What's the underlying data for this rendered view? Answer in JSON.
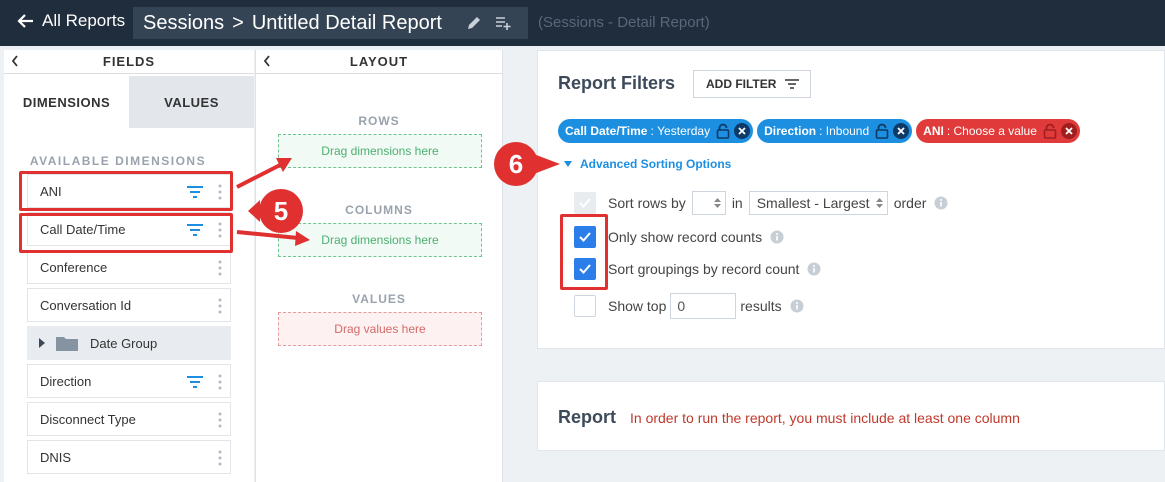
{
  "header": {
    "back_label": "All Reports",
    "breadcrumb_parent": "Sessions",
    "breadcrumb_separator": ">",
    "report_name": "Untitled Detail Report",
    "subtitle": "(Sessions - Detail Report)"
  },
  "fields_panel": {
    "title": "FIELDS",
    "tabs": [
      {
        "label": "DIMENSIONS",
        "active": true
      },
      {
        "label": "VALUES",
        "active": false
      }
    ],
    "available_label": "AVAILABLE DIMENSIONS",
    "items": [
      {
        "label": "ANI",
        "filter": true
      },
      {
        "label": "Call Date/Time",
        "filter": true
      },
      {
        "label": "Conference",
        "filter": false
      },
      {
        "label": "Conversation Id",
        "filter": false
      },
      {
        "label": "Date Group",
        "group": true
      },
      {
        "label": "Direction",
        "filter": true
      },
      {
        "label": "Disconnect Type",
        "filter": false
      },
      {
        "label": "DNIS",
        "filter": false
      }
    ]
  },
  "layout_panel": {
    "title": "LAYOUT",
    "rows_label": "ROWS",
    "rows_placeholder": "Drag dimensions here",
    "columns_label": "COLUMNS",
    "columns_placeholder": "Drag dimensions here",
    "values_label": "VALUES",
    "values_placeholder": "Drag values here"
  },
  "filters": {
    "title": "Report Filters",
    "add_filter_label": "ADD FILTER",
    "chips": [
      {
        "field": "Call Date/Time",
        "value": "Yesterday",
        "color": "#1d8fe1"
      },
      {
        "field": "Direction",
        "value": "Inbound",
        "color": "#1d8fe1"
      },
      {
        "field": "ANI",
        "value": "Choose a value",
        "color": "#e03a3a"
      }
    ],
    "advanced_sorting_label": "Advanced Sorting Options",
    "sort_rows_label": "Sort rows by",
    "sort_in_label": "in",
    "sort_order_value": "Smallest - Largest",
    "sort_order_suffix": "order",
    "only_counts_label": "Only show record counts",
    "sort_groupings_label": "Sort groupings by record count",
    "show_top_label": "Show top",
    "show_top_value": "0",
    "show_top_suffix": "results"
  },
  "report": {
    "title": "Report",
    "message": "In order to run the report, you must include at least one column"
  },
  "annotations": {
    "step_5": "5",
    "step_6": "6",
    "color": "#e03030"
  }
}
